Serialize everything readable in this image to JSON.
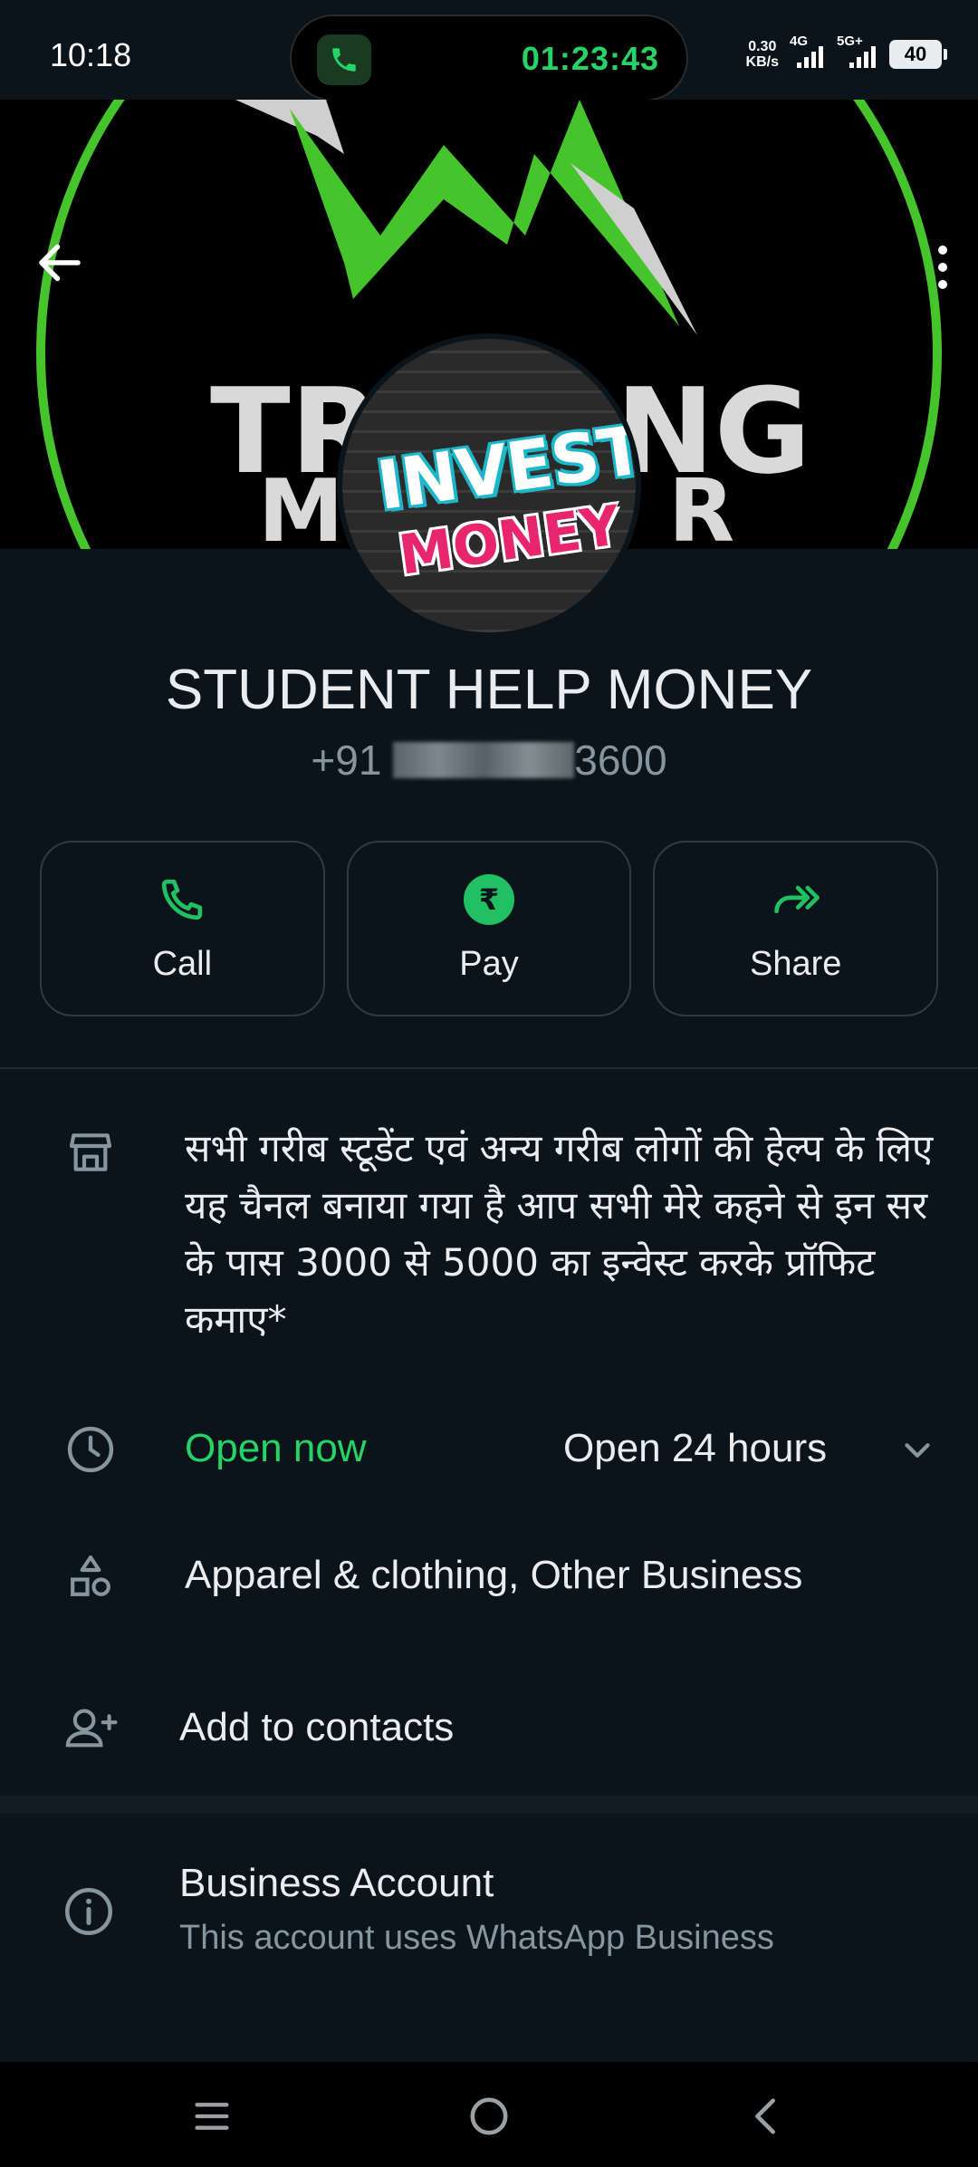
{
  "status_bar": {
    "time": "10:18",
    "call_timer": "01:23:43",
    "net_speed_value": "0.30",
    "net_speed_unit": "KB/s",
    "sim1_label": "4G",
    "sim2_label": "5G+",
    "battery": "40"
  },
  "cover": {
    "word1": "TR",
    "word2": "NG",
    "word3": "M",
    "word4": "R"
  },
  "avatar": {
    "line1": "INVEST",
    "line2": "MONEY"
  },
  "profile": {
    "name": "STUDENT HELP MONEY",
    "phone_prefix": "+91 ",
    "phone_suffix": "3600"
  },
  "actions": [
    {
      "label": "Call",
      "icon": "phone-icon"
    },
    {
      "label": "Pay",
      "icon": "rupee-icon"
    },
    {
      "label": "Share",
      "icon": "share-forward-icon"
    }
  ],
  "details": {
    "description": "सभी गरीब स्टूडेंट एवं अन्य गरीब लोगों की हेल्प के लिए यह चैनल बनाया गया है आप सभी मेरे कहने से इन सर के पास 3000 से 5000 का इन्वेस्ट करके प्रॉफिट कमाए*",
    "open_status": "Open now",
    "hours": "Open 24 hours",
    "category": "Apparel & clothing, Other Business",
    "add_contacts": "Add to contacts",
    "business_title": "Business Account",
    "business_sub": "This account uses WhatsApp Business"
  },
  "colors": {
    "background": "#0b141a",
    "accent_green": "#25d366",
    "secondary_text": "#8696a0"
  }
}
